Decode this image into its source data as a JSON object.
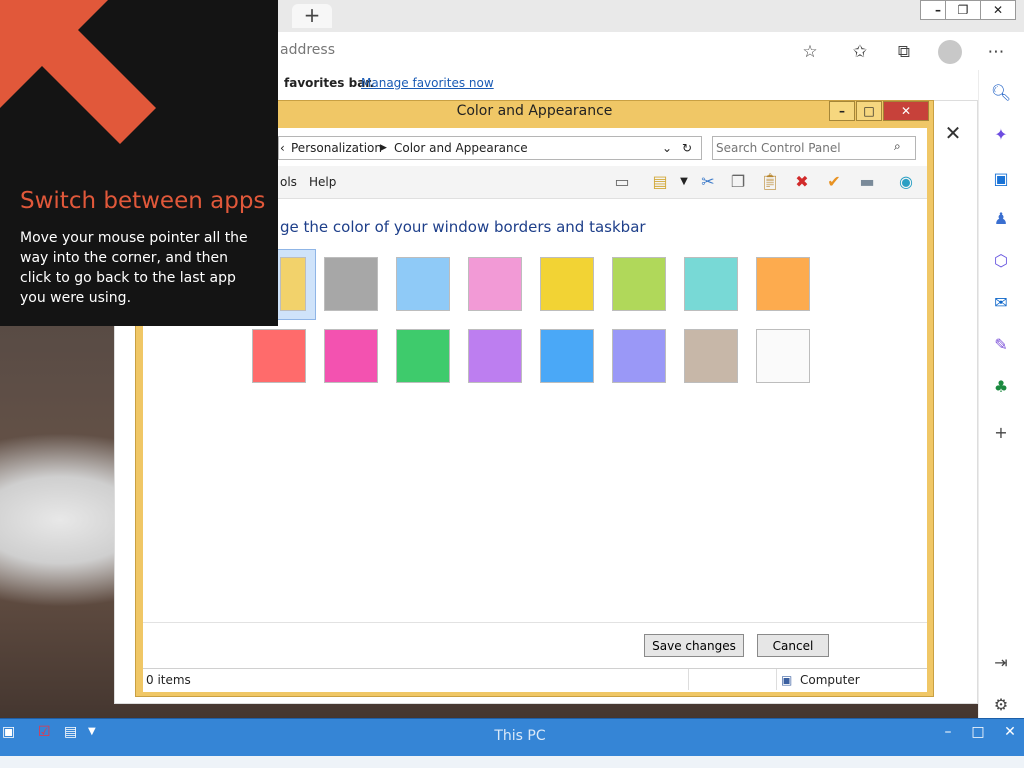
{
  "browser": {
    "address_placeholder": "address",
    "favorites_text": "favorites bar.",
    "favorites_link": "Manage favorites now",
    "new_tab_glyph": "+",
    "window_controls": [
      "–",
      "❐",
      "✕"
    ]
  },
  "control_panel": {
    "title": "Color and Appearance",
    "breadcrumb": [
      "Personalization",
      "Color and Appearance"
    ],
    "search_placeholder": "Search Control Panel",
    "menu": [
      "ols",
      "Help"
    ],
    "heading": "ge the color of your window borders and taskbar",
    "swatch_colors_row1": [
      "#f2d26b",
      "#a7a7a7",
      "#8fcaf7",
      "#f29ad6",
      "#f2d334",
      "#b0d85a",
      "#78d9d6",
      "#fdab4e"
    ],
    "swatch_colors_row2": [
      "#ff6b6b",
      "#f352b0",
      "#3ecb6c",
      "#bd7ef0",
      "#4aa8f7",
      "#9a98f7",
      "#c7b7a8",
      "#fafafa"
    ],
    "buttons": {
      "save": "Save changes",
      "cancel": "Cancel"
    },
    "status": {
      "items": "0 items",
      "location": "Computer"
    },
    "window_controls": [
      "–",
      "□",
      "✕"
    ]
  },
  "tip": {
    "title": "Switch between apps",
    "body": "Move your mouse pointer all the way into the corner, and then click to go back to the last app you were using."
  },
  "taskbar": {
    "title": "This PC"
  }
}
